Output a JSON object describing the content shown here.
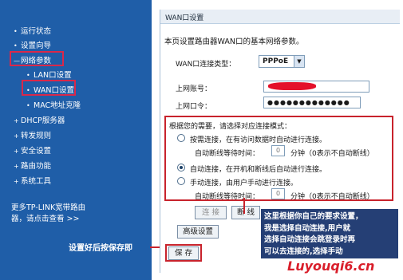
{
  "nav": {
    "items": [
      {
        "label": "运行状态",
        "bullet": "•"
      },
      {
        "label": "设置向导",
        "bullet": "•"
      },
      {
        "label": "网络参数",
        "bullet": "—"
      },
      {
        "label": "LAN口设置",
        "bullet": "•"
      },
      {
        "label": "WAN口设置",
        "bullet": "•"
      },
      {
        "label": "MAC地址克隆",
        "bullet": "•"
      },
      {
        "label": "DHCP服务器",
        "bullet": "+"
      },
      {
        "label": "转发规则",
        "bullet": "+"
      },
      {
        "label": "安全设置",
        "bullet": "+"
      },
      {
        "label": "路由功能",
        "bullet": "+"
      },
      {
        "label": "系统工具",
        "bullet": "+"
      }
    ],
    "promo_line1": "更多TP-LINK宽带路由",
    "promo_line2": "器，请点击查看 >>"
  },
  "panel": {
    "title": "WAN口设置",
    "description": "本页设置路由器WAN口的基本网络参数。",
    "conn_type_label": "WAN口连接类型：",
    "conn_type_value": "PPPoE",
    "account_label": "上网账号：",
    "password_label": "上网口令：",
    "password_value": "●●●●●●●●●●●●●",
    "mode_prompt": "根据您的需要，请选择对应连接模式：",
    "modes": [
      {
        "label": "按需连接，在有访问数据时自动进行连接。",
        "selected": false
      },
      {
        "label": "自动连接，在开机和断线后自动进行连接。",
        "selected": true
      },
      {
        "label": "手动连接，由用户手动进行连接。",
        "selected": false
      }
    ],
    "idle_label": "自动断线等待时间：",
    "idle_value": "0",
    "idle_unit": "分钟（0表示不自动断线）",
    "connect_button": "连 接",
    "disconnect_button": "断 线",
    "advanced_button": "高级设置",
    "save_button": "保 存"
  },
  "annotations": {
    "save_note": "设置好后按保存即",
    "callout_lines": [
      "这里根据你自己的要求设置，",
      "我是选择自动连接,用户就",
      "选择自动连接会跳登录时再",
      "可以去连接的,选择手动"
    ],
    "watermark": "Luyouqi6.cn"
  }
}
